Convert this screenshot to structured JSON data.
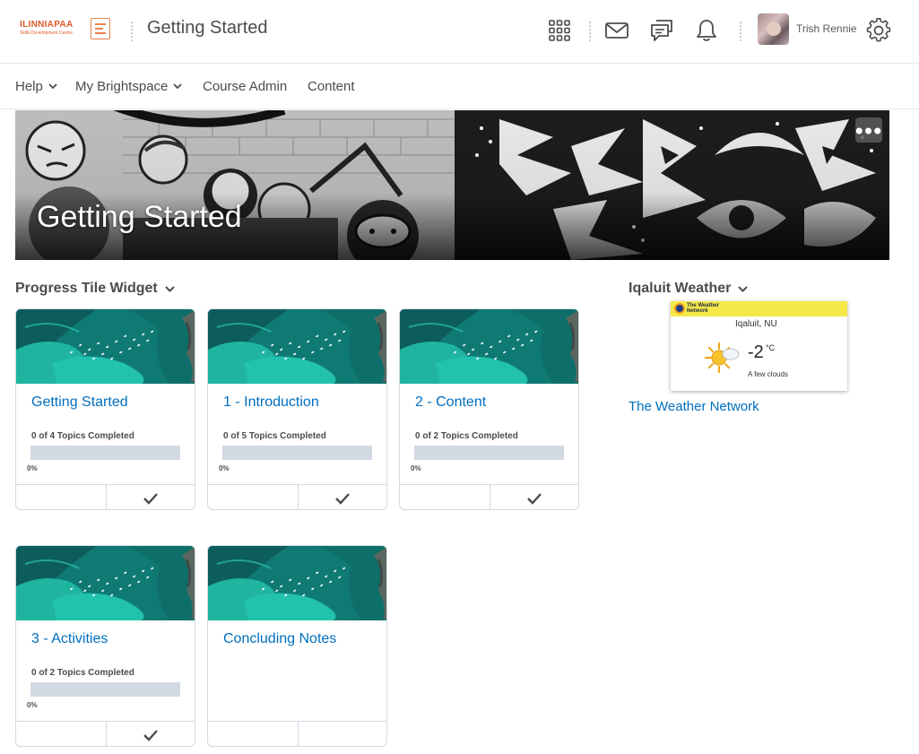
{
  "header": {
    "logo_line1": "ILINNIAPAA",
    "logo_line2": "Skills Development Centre",
    "course_title": "Getting Started",
    "user_name": "Trish Rennie",
    "icons": [
      "grid-icon",
      "mail-icon",
      "chat-icon",
      "bell-icon",
      "gear-icon"
    ]
  },
  "nav": {
    "items": [
      {
        "label": "Help",
        "dropdown": true
      },
      {
        "label": "My Brightspace",
        "dropdown": true
      },
      {
        "label": "Course Admin",
        "dropdown": false
      },
      {
        "label": "Content",
        "dropdown": false
      }
    ]
  },
  "banner": {
    "title": "Getting Started",
    "menu_label": "•••"
  },
  "progress_widget": {
    "heading": "Progress Tile Widget",
    "tiles": [
      {
        "name": "Getting Started",
        "count_text": "0 of 4 Topics Completed",
        "percent_text": "0%",
        "progress": 0,
        "show_progress": true
      },
      {
        "name": "1 - Introduction",
        "count_text": "0 of 5 Topics Completed",
        "percent_text": "0%",
        "progress": 0,
        "show_progress": true
      },
      {
        "name": "2 - Content",
        "count_text": "0 of 2 Topics Completed",
        "percent_text": "0%",
        "progress": 0,
        "show_progress": true
      },
      {
        "name": "3 - Activities",
        "count_text": "0 of 2 Topics Completed",
        "percent_text": "0%",
        "progress": 0,
        "show_progress": true
      },
      {
        "name": "Concluding Notes",
        "count_text": "",
        "percent_text": "",
        "progress": 0,
        "show_progress": false
      }
    ]
  },
  "weather_widget": {
    "heading": "Iqaluit Weather",
    "provider_line1": "The Weather",
    "provider_line2": "Network",
    "location": "Iqaluit, NU",
    "temperature": "-2",
    "unit": "°C",
    "condition": "A few clouds",
    "link_text": "The Weather Network",
    "top_color": "#f5e94a"
  },
  "colors": {
    "link": "#006fbf",
    "text": "#494c4e",
    "border": "#d3d9e3",
    "accent_orange": "#e05a2a"
  }
}
